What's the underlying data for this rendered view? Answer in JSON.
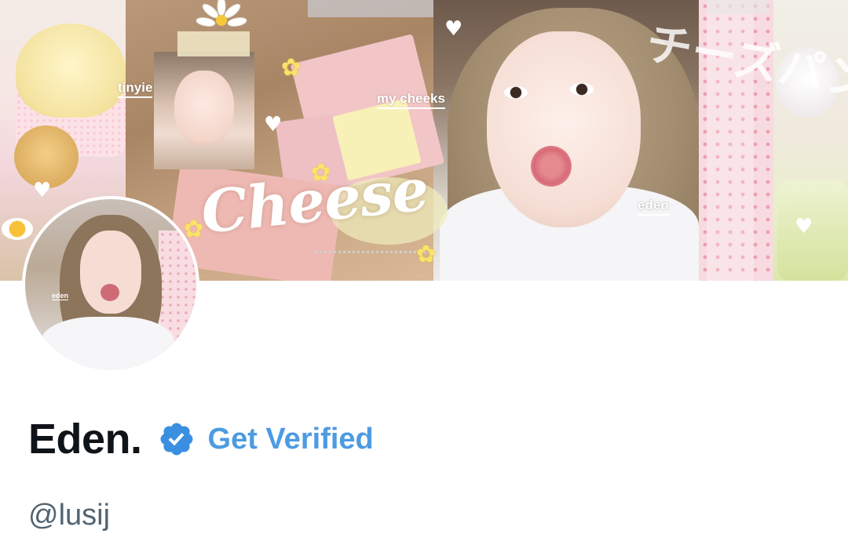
{
  "banner": {
    "tags": {
      "tinyie": "tinyie",
      "my_cheeks": "my cheeks",
      "eden": "eden"
    },
    "script_text": "Cheese",
    "japanese_text": "チーズパン"
  },
  "avatar": {
    "tag": "eden"
  },
  "profile": {
    "display_name": "Eden.",
    "verified_cta": "Get Verified",
    "handle": "@lusij"
  },
  "colors": {
    "name": "#0f1419",
    "verified_blue": "#4d9be2",
    "handle_gray": "#536471",
    "badge_blue": "#3b8fe0"
  },
  "icons": {
    "verified_badge": "verified-badge-icon",
    "heart": "heart-icon",
    "flower": "flower-icon"
  }
}
